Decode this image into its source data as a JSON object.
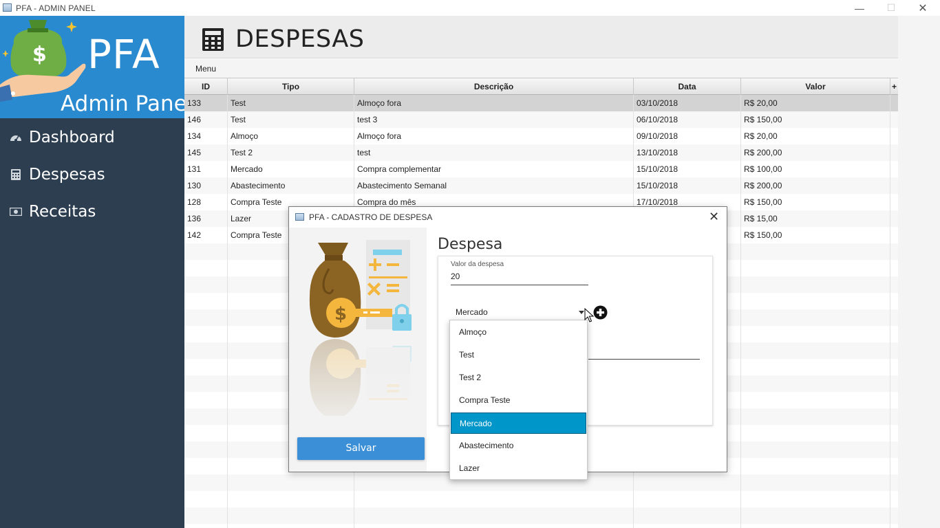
{
  "window": {
    "title": "PFA - ADMIN PANEL",
    "controls": {
      "minimize": "—",
      "maximize": "☐",
      "close": "✕"
    }
  },
  "sidebar": {
    "brand_title": "PFA",
    "brand_subtitle": "Admin Panel",
    "items": [
      {
        "label": "Dashboard",
        "icon": "dashboard-icon"
      },
      {
        "label": "Despesas",
        "icon": "calculator-icon"
      },
      {
        "label": "Receitas",
        "icon": "money-icon"
      }
    ]
  },
  "header": {
    "title": "DESPESAS",
    "icon": "calculator-icon"
  },
  "menubar": {
    "menu_label": "Menu"
  },
  "table": {
    "columns": [
      "ID",
      "Tipo",
      "Descrição",
      "Data",
      "Valor"
    ],
    "add_column_label": "+",
    "rows": [
      {
        "id": "133",
        "tipo": "Test",
        "descricao": "Almoço fora",
        "data": "03/10/2018",
        "valor": "R$ 20,00"
      },
      {
        "id": "146",
        "tipo": "Test",
        "descricao": "test 3",
        "data": "06/10/2018",
        "valor": "R$ 150,00"
      },
      {
        "id": "134",
        "tipo": "Almoço",
        "descricao": "Almoço fora",
        "data": "09/10/2018",
        "valor": "R$ 20,00"
      },
      {
        "id": "145",
        "tipo": "Test 2",
        "descricao": "test",
        "data": "13/10/2018",
        "valor": "R$ 200,00"
      },
      {
        "id": "131",
        "tipo": "Mercado",
        "descricao": "Compra complementar",
        "data": "15/10/2018",
        "valor": "R$ 100,00"
      },
      {
        "id": "130",
        "tipo": "Abastecimento",
        "descricao": "Abastecimento Semanal",
        "data": "15/10/2018",
        "valor": "R$ 200,00"
      },
      {
        "id": "128",
        "tipo": "Compra Teste",
        "descricao": "Compra do mês",
        "data": "17/10/2018",
        "valor": "R$ 150,00"
      },
      {
        "id": "136",
        "tipo": "Lazer",
        "descricao": "",
        "data": "",
        "valor": "R$ 15,00"
      },
      {
        "id": "142",
        "tipo": "Compra Teste",
        "descricao": "",
        "data": "",
        "valor": "R$ 150,00"
      }
    ]
  },
  "dialog": {
    "title": "PFA - CADASTRO DE DESPESA",
    "close": "✕",
    "heading": "Despesa",
    "valor_label": "Valor da despesa",
    "valor_value": "20",
    "tipo_selected": "Mercado",
    "save_label": "Salvar"
  },
  "dropdown": {
    "options": [
      "Almoço",
      "Test",
      "Test 2",
      "Compra Teste",
      "Mercado",
      "Abastecimento",
      "Lazer"
    ],
    "selected": "Mercado"
  },
  "colors": {
    "sidebar_bg": "#2c3e50",
    "brand_bg": "#2a8ad0",
    "accent": "#3a8fd6",
    "dropdown_selected": "#0096c9"
  }
}
